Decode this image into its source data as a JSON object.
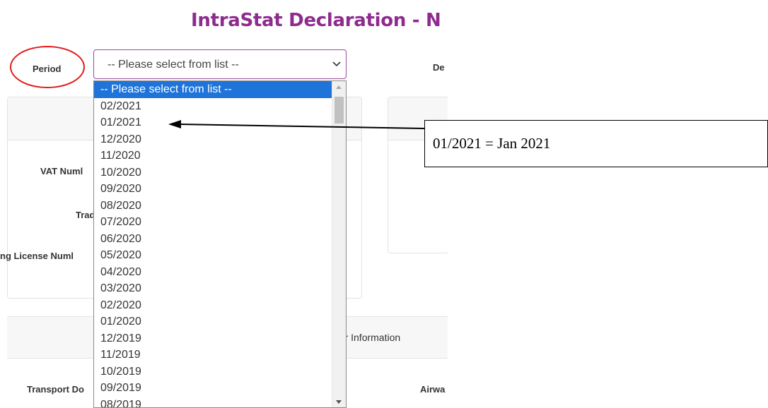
{
  "page": {
    "title": "IntraStat Declaration - N",
    "title_color": "#8e2b8e"
  },
  "form": {
    "period_label": "Period",
    "right_label_truncated": "De",
    "vat_label": "VAT Numl",
    "trade_label": "Trad",
    "license_label": "ng License Numl",
    "band_label": "her Information",
    "transport_label": "Transport Do",
    "airway_label": "Airwa"
  },
  "period_select": {
    "value": "-- Please select from list --",
    "accent": "#9a4ba0",
    "options": [
      "-- Please select from list --",
      "02/2021",
      "01/2021",
      "12/2020",
      "11/2020",
      "10/2020",
      "09/2020",
      "08/2020",
      "07/2020",
      "06/2020",
      "05/2020",
      "04/2020",
      "03/2020",
      "02/2020",
      "01/2020",
      "12/2019",
      "11/2019",
      "10/2019",
      "09/2019",
      "08/2019"
    ],
    "highlighted_index": 0,
    "highlight_color": "#1e74d9"
  },
  "annotation": {
    "callout_text": "01/2021 = Jan 2021",
    "circle_color": "#e51919",
    "arrow_color": "#000000"
  }
}
